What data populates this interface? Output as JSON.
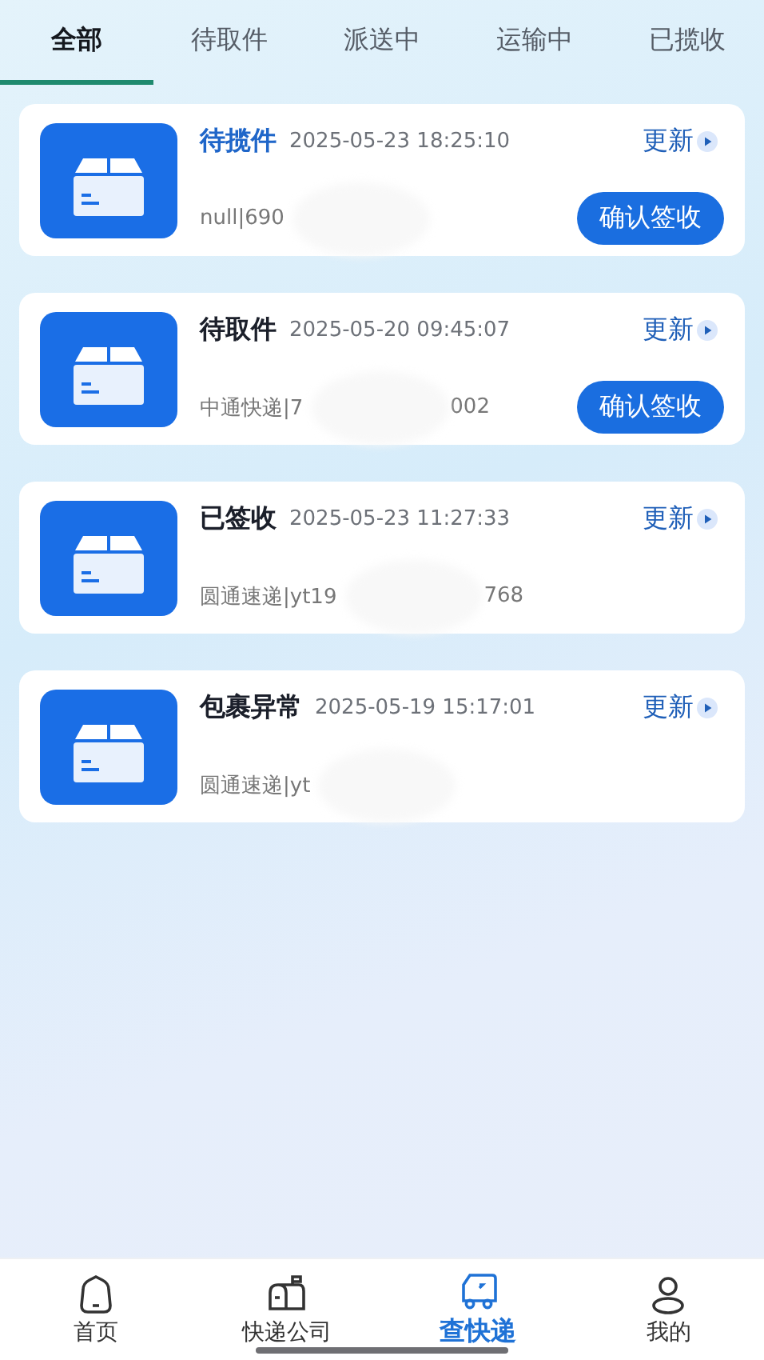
{
  "tabs": [
    {
      "label": "全部",
      "selected": true
    },
    {
      "label": "待取件",
      "selected": false
    },
    {
      "label": "派送中",
      "selected": false
    },
    {
      "label": "运输中",
      "selected": false
    },
    {
      "label": "已揽收",
      "selected": false
    }
  ],
  "shipments": [
    {
      "status": "待揽件",
      "color": "#1f66c9",
      "time": "2025-05-23 18:25:10",
      "refresh": "更新",
      "tracking_start": "null|690",
      "action": "确认签收"
    },
    {
      "status": "待取件",
      "color": "#1b1f2a",
      "time": "2025-05-20 09:45:07",
      "refresh": "更新",
      "tracking_start": "中通快递|7",
      "tracking_end": "002",
      "action": "确认签收"
    },
    {
      "status": "已签收",
      "color": "#1b1f2a",
      "time": "2025-05-23 11:27:33",
      "refresh": "更新",
      "tracking_start": "圆通速递|yt19",
      "tracking_end": "768"
    },
    {
      "status": "包裹异常",
      "color": "#1b1f2a",
      "time": "2025-05-19 15:17:01",
      "refresh": "更新",
      "tracking_start": "圆通速递|yt"
    }
  ],
  "bottom_nav": [
    {
      "label": "首页",
      "kind": "home",
      "selected": false
    },
    {
      "label": "快递公司",
      "kind": "mailbox",
      "selected": false
    },
    {
      "label": "查快递",
      "kind": "truck",
      "selected": true
    },
    {
      "label": "我的",
      "kind": "user",
      "selected": false
    }
  ]
}
